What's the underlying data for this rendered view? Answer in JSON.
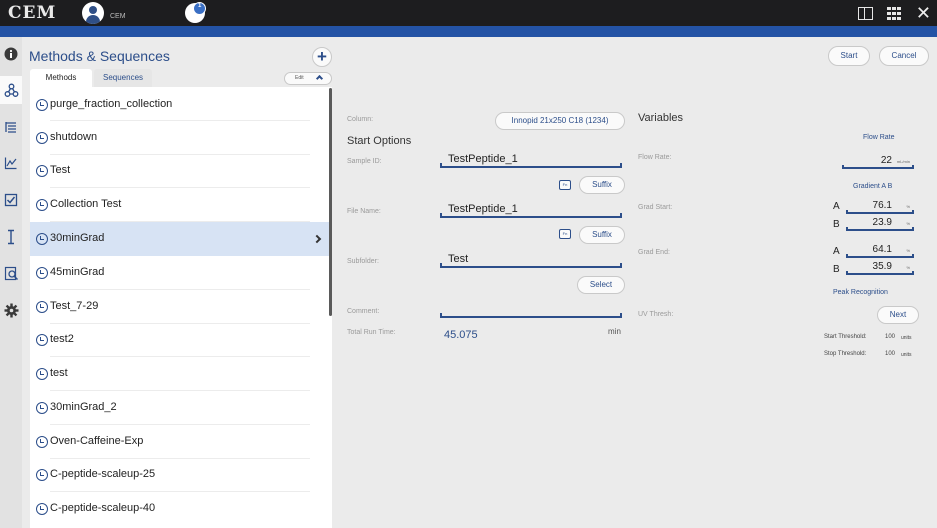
{
  "app": {
    "logo": "CEM",
    "user_name": "CEM",
    "instrument_badge": "1"
  },
  "sidebar": {
    "items": [
      {
        "name": "info-icon"
      },
      {
        "name": "methods-icon"
      },
      {
        "name": "sequence-list-icon"
      },
      {
        "name": "chart-icon"
      },
      {
        "name": "checkbox-icon"
      },
      {
        "name": "column-icon"
      },
      {
        "name": "search-document-icon"
      },
      {
        "name": "gear-icon"
      }
    ]
  },
  "methods_panel": {
    "title": "Methods & Sequences",
    "tabs": [
      "Methods",
      "Sequences"
    ],
    "edit_label": "Edit",
    "items": [
      "purge_fraction_collection",
      "shutdown",
      "Test",
      "Collection Test",
      "30minGrad",
      "45minGrad",
      "Test_7-29",
      "test2",
      "test",
      "30minGrad_2",
      "Oven-Caffeine-Exp",
      "C-peptide-scaleup-25",
      "C-peptide-scaleup-40"
    ],
    "selected_index": 4
  },
  "header": {
    "start_label": "Start",
    "cancel_label": "Cancel"
  },
  "column": {
    "label": "Column:",
    "value": "Innopid 21x250 C18 (1234)"
  },
  "start_options": {
    "title": "Start Options",
    "sample_id": {
      "label": "Sample ID:",
      "value": "TestPeptide_1",
      "fn_label": "Fn",
      "suffix_label": "Suffix"
    },
    "file_name": {
      "label": "File Name:",
      "value": "TestPeptide_1",
      "fn_label": "Fn",
      "suffix_label": "Suffix"
    },
    "subfolder": {
      "label": "Subfolder:",
      "value": "Test",
      "select_label": "Select"
    },
    "comment": {
      "label": "Comment:",
      "value": ""
    },
    "total_run_time": {
      "label": "Total Run Time:",
      "value": "45.075",
      "unit": "min"
    }
  },
  "variables": {
    "title": "Variables",
    "flow_rate": {
      "header": "Flow Rate",
      "label": "Flow Rate:",
      "value": "22",
      "unit": "mL/min"
    },
    "gradient_header": "Gradient A B",
    "grad_start": {
      "label": "Grad Start:",
      "a_label": "A",
      "a_value": "76.1",
      "b_label": "B",
      "b_value": "23.9",
      "unit": "%"
    },
    "grad_end": {
      "label": "Grad End:",
      "a_label": "A",
      "a_value": "64.1",
      "b_label": "B",
      "b_value": "35.9",
      "unit": "%"
    },
    "peak_recognition": {
      "header": "Peak Recognition",
      "uv_label": "UV Thresh:",
      "next_label": "Next",
      "start_threshold_label": "Start Threshold:",
      "start_threshold_value": "100",
      "stop_threshold_label": "Stop Threshold:",
      "stop_threshold_value": "100",
      "threshold_unit": "units"
    }
  }
}
